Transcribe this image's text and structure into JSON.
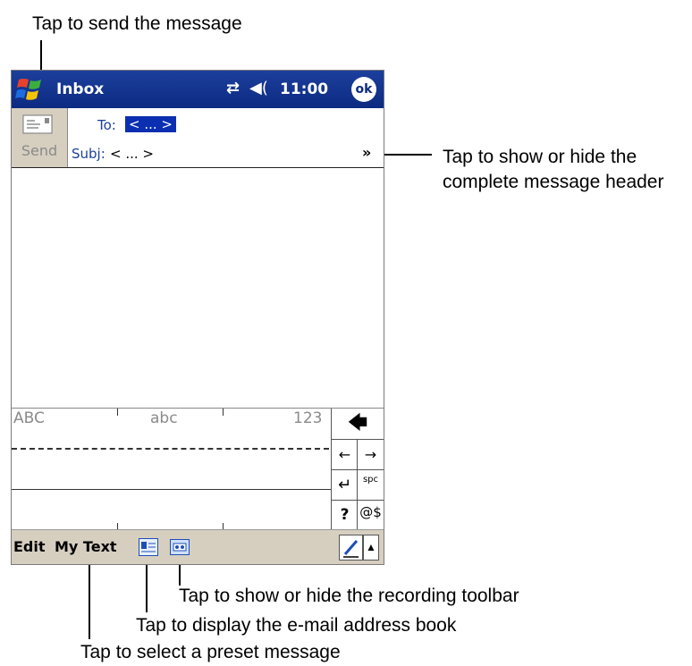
{
  "callouts": {
    "send": "Tap to send the message",
    "header_line1": "Tap to show or hide the",
    "header_line2": "complete message header",
    "recording": "Tap to show or hide the recording toolbar",
    "addressbook": "Tap to display the e-mail address book",
    "preset": "Tap to select a preset message"
  },
  "titlebar": {
    "title": "Inbox",
    "time": "11:00",
    "ok_label": "ok",
    "connectivity_icon": "connectivity-icon",
    "volume_icon": "speaker-icon",
    "start_icon": "windows-flag-icon"
  },
  "header": {
    "send_label": "Send",
    "to_label": "To:",
    "to_value": "< ... >",
    "subj_label": "Subj:",
    "subj_value": "< ... >",
    "expand_icon": "double-chevron-down-icon"
  },
  "input_panel": {
    "mode_upper": "ABC",
    "mode_lower": "abc",
    "mode_numeric": "123",
    "keys": {
      "backspace": "🡄",
      "left": "←",
      "right": "→",
      "enter": "↵",
      "space": "spc",
      "help": "?",
      "symbol": "@$"
    }
  },
  "menubar": {
    "edit": "Edit",
    "my_text": "My Text"
  },
  "colors": {
    "titlebar": "#0c2a82",
    "selection": "#0b2fb0",
    "menubar": "#d6cfc0"
  }
}
